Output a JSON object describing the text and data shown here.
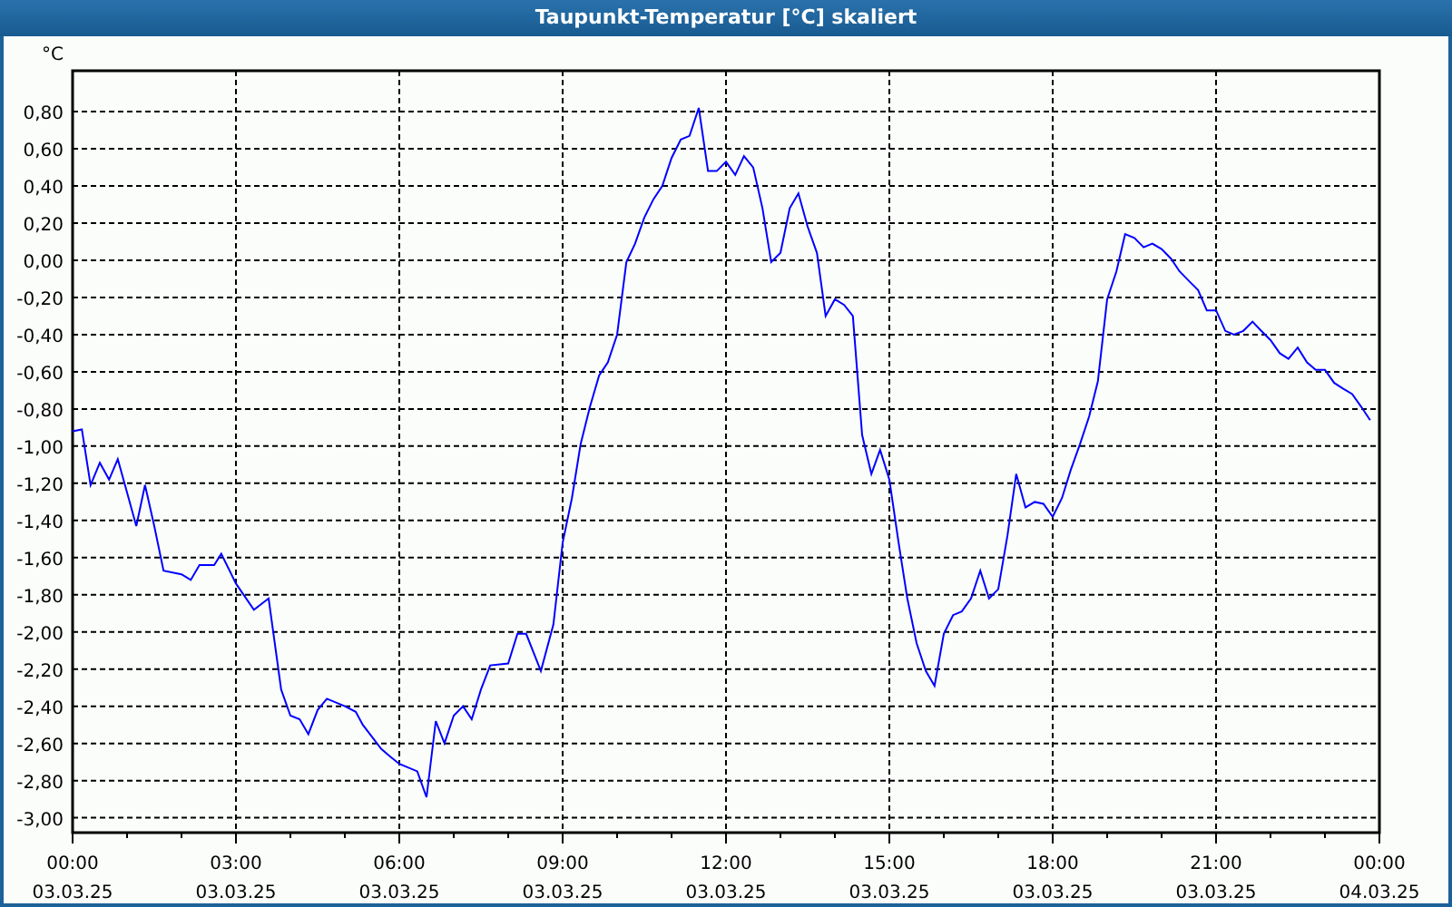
{
  "window": {
    "title": "Taupunkt-Temperatur [°C] skaliert"
  },
  "chart": {
    "chart_data": {
      "type": "line",
      "ylabel": "°C",
      "xlim": [
        0,
        24
      ],
      "ylim": [
        -3.08,
        1.02
      ],
      "yticks": [
        {
          "value": 0.8,
          "label": "0,80"
        },
        {
          "value": 0.6,
          "label": "0,60"
        },
        {
          "value": 0.4,
          "label": "0,40"
        },
        {
          "value": 0.2,
          "label": "0,20"
        },
        {
          "value": 0,
          "label": "0,00"
        },
        {
          "value": -0.2,
          "label": "-0,20"
        },
        {
          "value": -0.4,
          "label": "-0,40"
        },
        {
          "value": -0.6,
          "label": "-0,60"
        },
        {
          "value": -0.8,
          "label": "-0,80"
        },
        {
          "value": -1,
          "label": "-1,00"
        },
        {
          "value": -1.2,
          "label": "-1,20"
        },
        {
          "value": -1.4,
          "label": "-1,40"
        },
        {
          "value": -1.6,
          "label": "-1,60"
        },
        {
          "value": -1.8,
          "label": "-1,80"
        },
        {
          "value": -2,
          "label": "-2,00"
        },
        {
          "value": -2.2,
          "label": "-2,20"
        },
        {
          "value": -2.4,
          "label": "-2,40"
        },
        {
          "value": -2.6,
          "label": "-2,60"
        },
        {
          "value": -2.8,
          "label": "-2,80"
        },
        {
          "value": -3,
          "label": "-3,00"
        }
      ],
      "grid": true,
      "xticks": [
        {
          "value": 0,
          "label": "00:00"
        },
        {
          "value": 3,
          "label": "03:00"
        },
        {
          "value": 6,
          "label": "06:00"
        },
        {
          "value": 9,
          "label": "09:00"
        },
        {
          "value": 12,
          "label": "12:00"
        },
        {
          "value": 15,
          "label": "15:00"
        },
        {
          "value": 18,
          "label": "18:00"
        },
        {
          "value": 21,
          "label": "21:00"
        },
        {
          "value": 24,
          "label": "00:00"
        }
      ],
      "annotations": [
        "03.03.25",
        "03.03.25",
        "03.03.25",
        "03.03.25",
        "03.03.25",
        "03.03.25",
        "03.03.25",
        "03.03.25",
        "04.03.25"
      ],
      "x": [
        0,
        0.17,
        0.33,
        0.5,
        0.67,
        0.83,
        1,
        1.17,
        1.33,
        1.5,
        1.67,
        2,
        2.17,
        2.33,
        2.6,
        2.73,
        3,
        3.33,
        3.6,
        3.83,
        4,
        4.17,
        4.33,
        4.5,
        4.67,
        5,
        5.2,
        5.33,
        5.67,
        5.83,
        6,
        6.33,
        6.5,
        6.67,
        6.83,
        7,
        7.17,
        7.33,
        7.5,
        7.67,
        8,
        8.17,
        8.33,
        8.6,
        8.83,
        9,
        9.17,
        9.33,
        9.5,
        9.67,
        9.83,
        10,
        10.17,
        10.33,
        10.5,
        10.67,
        10.83,
        11,
        11.17,
        11.33,
        11.5,
        11.67,
        11.83,
        12,
        12.17,
        12.33,
        12.5,
        12.67,
        12.83,
        13,
        13.17,
        13.33,
        13.5,
        13.67,
        13.83,
        14,
        14.17,
        14.33,
        14.5,
        14.67,
        14.83,
        15,
        15.17,
        15.33,
        15.5,
        15.67,
        15.83,
        16,
        16.17,
        16.33,
        16.5,
        16.67,
        16.83,
        17,
        17.17,
        17.33,
        17.5,
        17.67,
        17.83,
        18,
        18.17,
        18.33,
        18.5,
        18.67,
        18.83,
        19,
        19.17,
        19.33,
        19.5,
        19.67,
        19.83,
        20,
        20.17,
        20.33,
        20.5,
        20.67,
        20.83,
        21,
        21.17,
        21.33,
        21.5,
        21.67,
        21.83,
        22,
        22.17,
        22.33,
        22.5,
        22.67,
        22.83,
        23,
        23.17,
        23.33,
        23.5,
        23.67,
        23.83
      ],
      "series": [
        {
          "color": "#0000ff",
          "values": [
            -0.92,
            -0.91,
            -1.21,
            -1.09,
            -1.18,
            -1.07,
            -1.25,
            -1.43,
            -1.21,
            -1.43,
            -1.67,
            -1.69,
            -1.72,
            -1.64,
            -1.64,
            -1.58,
            -1.74,
            -1.88,
            -1.82,
            -2.31,
            -2.45,
            -2.47,
            -2.55,
            -2.42,
            -2.36,
            -2.4,
            -2.43,
            -2.5,
            -2.63,
            -2.67,
            -2.71,
            -2.75,
            -2.89,
            -2.48,
            -2.6,
            -2.45,
            -2.4,
            -2.47,
            -2.31,
            -2.18,
            -2.17,
            -2.01,
            -2.01,
            -2.21,
            -1.96,
            -1.52,
            -1.28,
            -0.99,
            -0.79,
            -0.62,
            -0.55,
            -0.4,
            -0.01,
            0.09,
            0.23,
            0.33,
            0.4,
            0.55,
            0.65,
            0.67,
            0.82,
            0.48,
            0.48,
            0.53,
            0.46,
            0.56,
            0.5,
            0.28,
            -0.01,
            0.04,
            0.28,
            0.36,
            0.18,
            0.04,
            -0.3,
            -0.21,
            -0.24,
            -0.3,
            -0.94,
            -1.15,
            -1.02,
            -1.18,
            -1.52,
            -1.82,
            -2.06,
            -2.21,
            -2.29,
            -2.01,
            -1.91,
            -1.89,
            -1.82,
            -1.67,
            -1.82,
            -1.77,
            -1.48,
            -1.15,
            -1.33,
            -1.3,
            -1.31,
            -1.38,
            -1.28,
            -1.13,
            -0.99,
            -0.84,
            -0.65,
            -0.21,
            -0.06,
            0.14,
            0.12,
            0.07,
            0.09,
            0.06,
            0.01,
            -0.06,
            -0.11,
            -0.16,
            -0.27,
            -0.27,
            -0.38,
            -0.4,
            -0.38,
            -0.33,
            -0.38,
            -0.43,
            -0.5,
            -0.53,
            -0.47,
            -0.55,
            -0.59,
            -0.59,
            -0.66,
            -0.69,
            -0.72,
            -0.79,
            -0.86
          ]
        }
      ]
    }
  }
}
